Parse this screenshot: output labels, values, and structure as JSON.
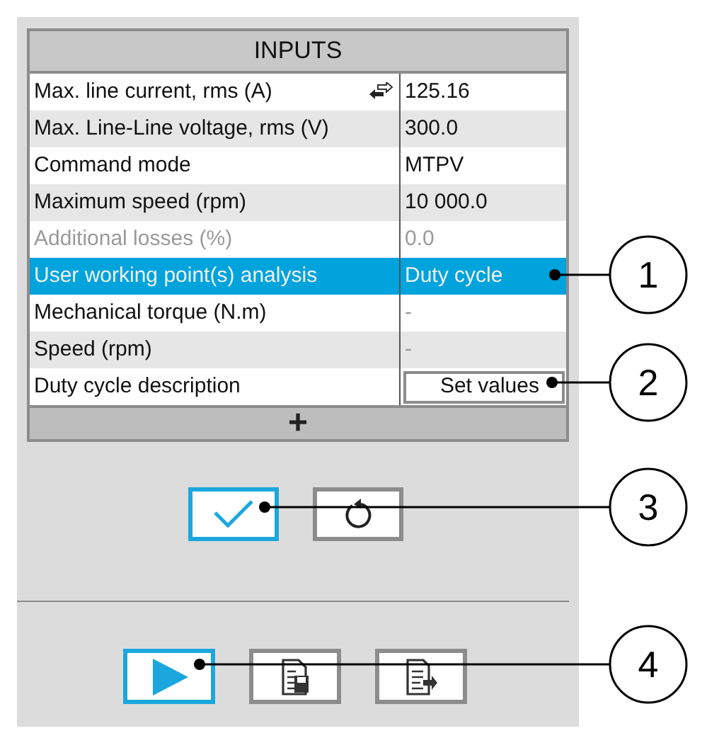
{
  "title": "INPUTS",
  "rows": [
    {
      "label": "Max. line current, rms (A)",
      "value": "125.16",
      "kind": "linked",
      "disabled": false,
      "value_disabled": false,
      "selected": false
    },
    {
      "label": "Max. Line-Line voltage, rms (V)",
      "value": "300.0",
      "kind": "text",
      "disabled": false,
      "value_disabled": false,
      "selected": false
    },
    {
      "label": "Command mode",
      "value": "MTPV",
      "kind": "text",
      "disabled": false,
      "value_disabled": false,
      "selected": false
    },
    {
      "label": "Maximum speed (rpm)",
      "value": "10 000.0",
      "kind": "text",
      "disabled": false,
      "value_disabled": false,
      "selected": false
    },
    {
      "label": "Additional losses (%)",
      "value": "0.0",
      "kind": "text",
      "disabled": true,
      "value_disabled": true,
      "selected": false
    },
    {
      "label": "User working point(s) analysis",
      "value": "Duty cycle",
      "kind": "text",
      "disabled": false,
      "value_disabled": false,
      "selected": true
    },
    {
      "label": "Mechanical torque (N.m)",
      "value": "-",
      "kind": "text",
      "disabled": false,
      "value_disabled": true,
      "selected": false
    },
    {
      "label": "Speed (rpm)",
      "value": "-",
      "kind": "text",
      "disabled": false,
      "value_disabled": true,
      "selected": false
    },
    {
      "label": "Duty cycle description",
      "value": "Set values",
      "kind": "button",
      "disabled": false,
      "value_disabled": false,
      "selected": false
    }
  ],
  "add_button": "+",
  "actions": [
    {
      "kind": "check",
      "selected": true
    },
    {
      "kind": "reset",
      "selected": false
    }
  ],
  "tools": [
    {
      "kind": "run",
      "selected": true
    },
    {
      "kind": "save",
      "selected": false
    },
    {
      "kind": "export",
      "selected": false
    }
  ],
  "callouts": [
    "1",
    "2",
    "3",
    "4"
  ]
}
